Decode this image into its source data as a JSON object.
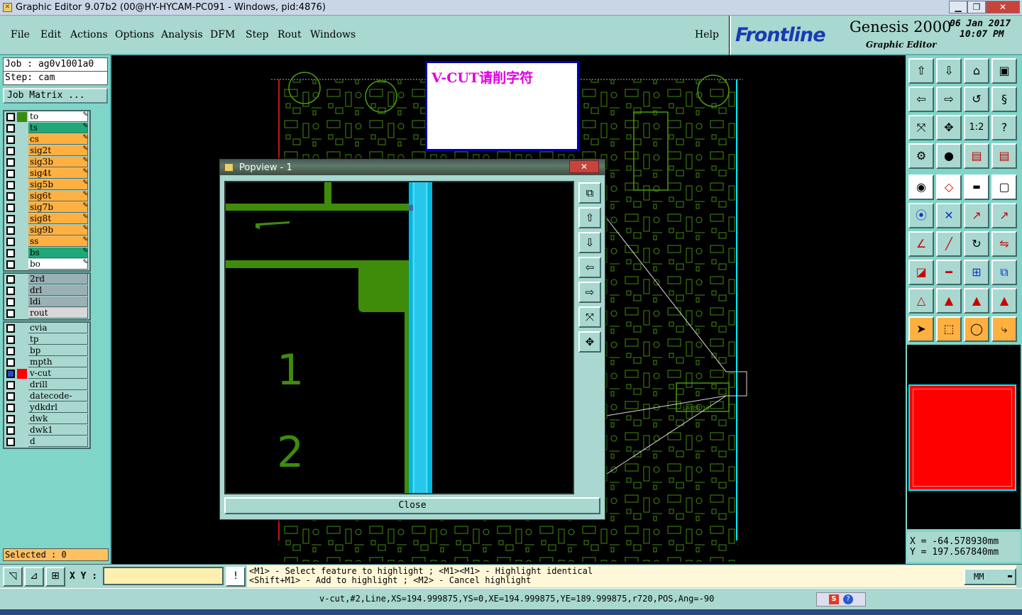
{
  "window": {
    "title": "Graphic Editor 9.07b2 (00@HY-HYCAM-PC091 - Windows, pid:4876)"
  },
  "menu": {
    "items": [
      "File",
      "Edit",
      "Actions",
      "Options",
      "Analysis",
      "DFM",
      "Step",
      "Rout",
      "Windows"
    ],
    "help": "Help"
  },
  "brand": {
    "logo": "Frontline",
    "product": "Genesis 2000",
    "subtitle": "Graphic Editor",
    "date": "06 Jan 2017",
    "time": "10:07 PM"
  },
  "job": {
    "job_label": "Job : ag0v1001a0",
    "step_label": "Step: cam",
    "matrix_button": "Job Matrix ..."
  },
  "layers": {
    "board": [
      {
        "name": "to",
        "color": "#ffffff",
        "swatch": "#3a8a10"
      },
      {
        "name": "ts",
        "color": "#20a878",
        "swatch": ""
      },
      {
        "name": "cs",
        "color": "#ffb040",
        "swatch": ""
      },
      {
        "name": "sig2t",
        "color": "#ffb040",
        "swatch": ""
      },
      {
        "name": "sig3b",
        "color": "#ffb040",
        "swatch": ""
      },
      {
        "name": "sig4t",
        "color": "#ffb040",
        "swatch": ""
      },
      {
        "name": "sig5b",
        "color": "#ffb040",
        "swatch": ""
      },
      {
        "name": "sig6t",
        "color": "#ffb040",
        "swatch": ""
      },
      {
        "name": "sig7b",
        "color": "#ffb040",
        "swatch": ""
      },
      {
        "name": "sig8t",
        "color": "#ffb040",
        "swatch": ""
      },
      {
        "name": "sig9b",
        "color": "#ffb040",
        "swatch": ""
      },
      {
        "name": "ss",
        "color": "#ffb040",
        "swatch": ""
      },
      {
        "name": "bs",
        "color": "#20a878",
        "swatch": ""
      },
      {
        "name": "bo",
        "color": "#ffffff",
        "swatch": ""
      }
    ],
    "drill": [
      {
        "name": "2rd",
        "color": "#9ab0b4"
      },
      {
        "name": "drl",
        "color": "#9ab0b4"
      },
      {
        "name": "ldi",
        "color": "#9ab0b4"
      },
      {
        "name": "rout",
        "color": "#d8d8d8"
      }
    ],
    "misc": [
      {
        "name": "cvia",
        "color": "#a8d8d0",
        "swatch": ""
      },
      {
        "name": "tp",
        "color": "#a8d8d0",
        "swatch": ""
      },
      {
        "name": "bp",
        "color": "#a8d8d0",
        "swatch": ""
      },
      {
        "name": "mpth",
        "color": "#a8d8d0",
        "swatch": ""
      },
      {
        "name": "v-cut",
        "color": "#a8d8d0",
        "swatch": "#ff0000"
      },
      {
        "name": "drill",
        "color": "#a8d8d0",
        "swatch": ""
      },
      {
        "name": "datecode-pbc",
        "color": "#a8d8d0",
        "swatch": ""
      },
      {
        "name": "ydkdrl",
        "color": "#a8d8d0",
        "swatch": ""
      },
      {
        "name": "dwk",
        "color": "#a8d8d0",
        "swatch": ""
      },
      {
        "name": "dwk1",
        "color": "#a8d8d0",
        "swatch": ""
      },
      {
        "name": "d",
        "color": "#a8d8d0",
        "swatch": ""
      }
    ]
  },
  "selected": "Selected : 0",
  "note": {
    "text": "V-CUT请削字符"
  },
  "popup": {
    "title": "Popview - 1",
    "close_label": "Close",
    "labels": [
      "1",
      "2"
    ]
  },
  "coords": {
    "x": "X  = -64.578930mm",
    "y": "Y  = 197.567840mm"
  },
  "bottom": {
    "xy_label": "X Y :",
    "xy_value": "",
    "hint1": "<M1> - Select feature to highlight ; <M1><M1> - Highlight identical",
    "hint2": "<Shift+M1> - Add to highlight ; <M2> - Cancel highlight",
    "units": "MM",
    "status": "v-cut,#2,Line,XS=194.999875,YS=0,XE=194.999875,YE=189.999875,r720,POS,Ang=-90"
  },
  "colors": {
    "accent": "#7fd6c8",
    "panel": "#a8d8d0",
    "copper": "#4a9a10",
    "vcut": "#00e8ff",
    "outline": "#ff2020"
  }
}
